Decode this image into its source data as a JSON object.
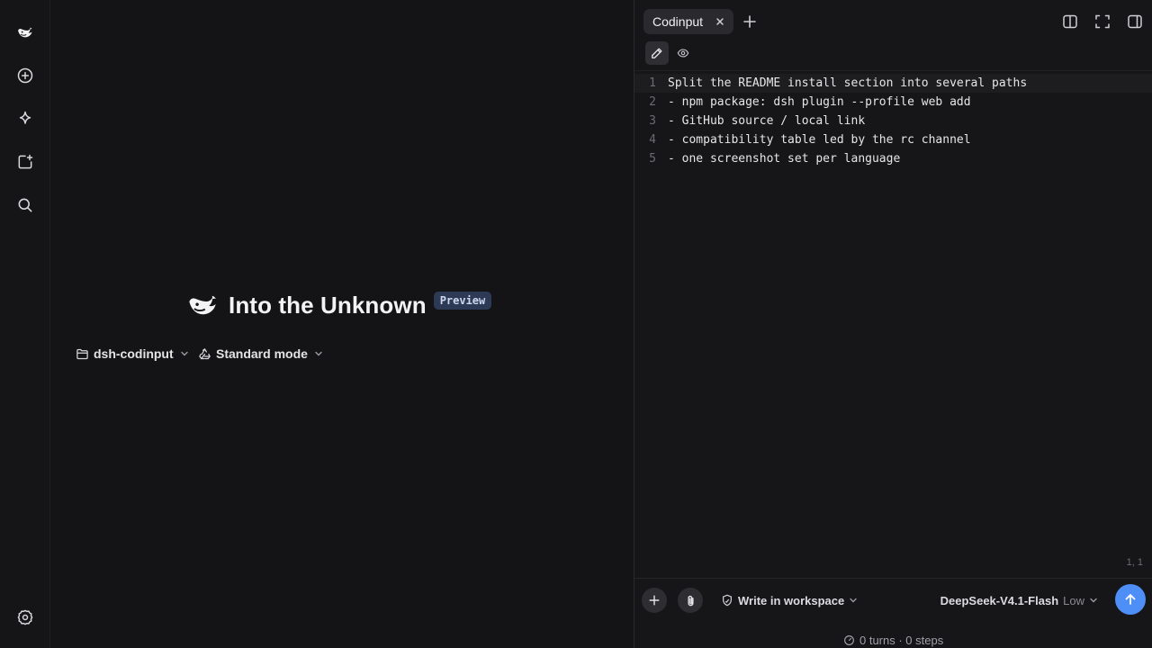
{
  "sidebar": {
    "items": [
      {
        "name": "new-chat",
        "icon": "plus-circle-icon"
      },
      {
        "name": "explore",
        "icon": "sparkle-icon"
      },
      {
        "name": "new-project",
        "icon": "folder-plus-icon"
      },
      {
        "name": "search",
        "icon": "search-icon"
      }
    ],
    "settings_icon": "gear-icon"
  },
  "hero": {
    "title": "Into the Unknown",
    "badge": "Preview"
  },
  "selectors": {
    "workspace": "dsh-codinput",
    "mode": "Standard mode"
  },
  "editor": {
    "tab_label": "Codinput",
    "lines": [
      {
        "num": "1",
        "text": "Split the README install section into several paths"
      },
      {
        "num": "2",
        "text": "- npm package: dsh plugin --profile web add"
      },
      {
        "num": "3",
        "text": "- GitHub source / local link"
      },
      {
        "num": "4",
        "text": "- compatibility table led by the rc channel"
      },
      {
        "num": "5",
        "text": "- one screenshot set per language"
      }
    ],
    "cursor_position": "1, 1"
  },
  "composer": {
    "write_scope": "Write in workspace",
    "model": "DeepSeek-V4.1-Flash",
    "effort": "Low",
    "status": "0 turns · 0 steps"
  },
  "colors": {
    "accent": "#4d8ef7",
    "background": "#141416",
    "badge_bg": "#2d3a55"
  }
}
